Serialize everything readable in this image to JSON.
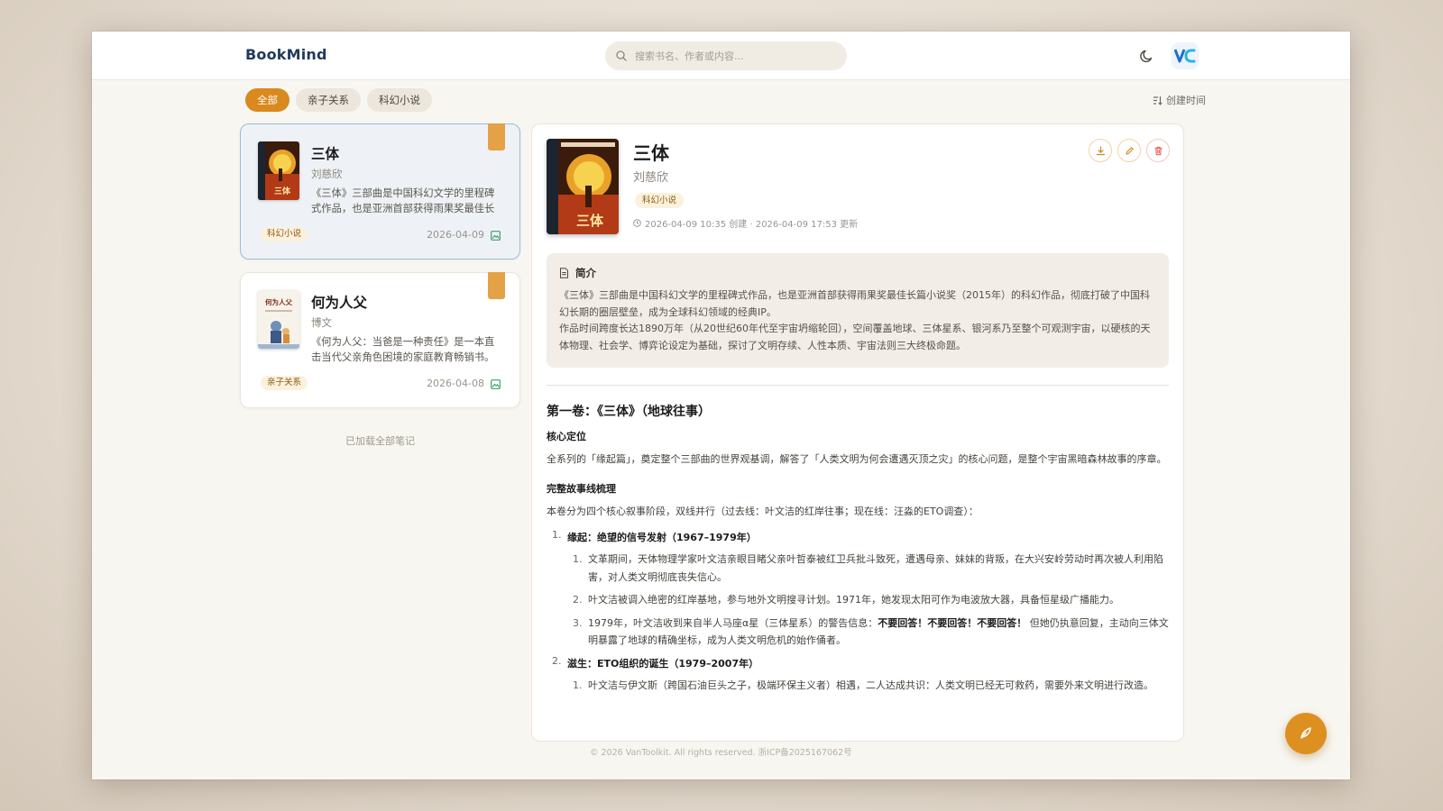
{
  "header": {
    "brand": "BookMind",
    "search_placeholder": "搜索书名、作者或内容...",
    "theme_icon": "moon-icon",
    "app_logo": "vk-logo-icon"
  },
  "filters": {
    "chips": [
      "全部",
      "亲子关系",
      "科幻小说"
    ],
    "active": "全部",
    "sort_label": "创建时间"
  },
  "notes": [
    {
      "title": "三体",
      "author": "刘慈欣",
      "excerpt": "《三体》三部曲是中国科幻文学的里程碑式作品，也是亚洲首部获得雨果奖最佳长篇小说奖的科幻作品。",
      "tag": "科幻小说",
      "date": "2026-04-09",
      "cover_text": "三体",
      "selected": true
    },
    {
      "title": "何为人父",
      "author": "博文",
      "excerpt": "《何为人父：当爸是一种责任》是一本直击当代父亲角色困境的家庭教育畅销书。",
      "tag": "亲子关系",
      "date": "2026-04-08",
      "cover_text": "何为人父",
      "selected": false
    }
  ],
  "list_end_text": "已加载全部笔记",
  "detail": {
    "title": "三体",
    "author": "刘慈欣",
    "tag": "科幻小说",
    "meta": "2026-04-09 10:35 创建 · 2026-04-09 17:53 更新",
    "summary_title": "简介",
    "summary_p1": "《三体》三部曲是中国科幻文学的里程碑式作品，也是亚洲首部获得雨果奖最佳长篇小说奖（2015年）的科幻作品，彻底打破了中国科幻长期的圈层壁垒，成为全球科幻领域的经典IP。",
    "summary_p2": "作品时间跨度长达1890万年（从20世纪60年代至宇宙坍缩轮回），空间覆盖地球、三体星系、银河系乃至整个可观测宇宙，以硬核的天体物理、社会学、博弈论设定为基础，探讨了文明存续、人性本质、宇宙法则三大终极命题。",
    "h2": "第一卷：《三体》（地球往事）",
    "sec1_title": "核心定位",
    "sec1_text": "全系列的「缘起篇」，奠定整个三部曲的世界观基调，解答了「人类文明为何会遭遇灭顶之灾」的核心问题，是整个宇宙黑暗森林故事的序章。",
    "sec2_title": "完整故事线梳理",
    "sec2_text": "本卷分为四个核心叙事阶段，双线并行（过去线：叶文洁的红岸往事；现在线：汪淼的ETO调查）：",
    "stage1_num": "1.",
    "stage1_title": "缘起：绝望的信号发射（1967–1979年）",
    "stage1_items": [
      {
        "num": "1.",
        "text": "文革期间，天体物理学家叶文洁亲眼目睹父亲叶哲泰被红卫兵批斗致死，遭遇母亲、妹妹的背叛，在大兴安岭劳动时再次被人利用陷害，对人类文明彻底丧失信心。"
      },
      {
        "num": "2.",
        "text": "叶文洁被调入绝密的红岸基地，参与地外文明搜寻计划。1971年，她发现太阳可作为电波放大器，具备恒星级广播能力。"
      },
      {
        "num": "3.",
        "text_a": "1979年，叶文洁收到来自半人马座α星（三体星系）的警告信息：",
        "text_bold": "不要回答！不要回答！不要回答！",
        "text_b": " 但她仍执意回复，主动向三体文明暴露了地球的精确坐标，成为人类文明危机的始作俑者。"
      }
    ],
    "stage2_num": "2.",
    "stage2_title": "滋生：ETO组织的诞生（1979–2007年）",
    "stage2_items": [
      {
        "num": "1.",
        "text": "叶文洁与伊文斯（跨国石油巨头之子，极端环保主义者）相遇，二人达成共识：人类文明已经无可救药，需要外来文明进行改造。"
      }
    ]
  },
  "footer": "© 2026 VanToolkit. All rights reserved. 浙ICP备2025167062号",
  "colors": {
    "accent": "#d9891d",
    "selected_border": "#9fbbd8",
    "delete": "#e05555"
  }
}
